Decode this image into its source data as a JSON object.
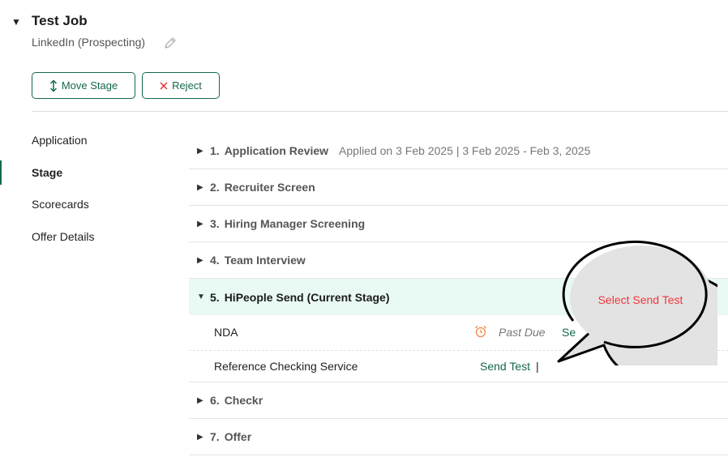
{
  "job": {
    "title": "Test Job",
    "subtitle": "LinkedIn (Prospecting)",
    "toggle_icon": "triangle-down",
    "edit_icon": "pencil-icon"
  },
  "actions": {
    "move_stage_label": "Move Stage",
    "reject_label": "Reject"
  },
  "sidenav": {
    "items": [
      {
        "label": "Application",
        "active": false
      },
      {
        "label": "Stage",
        "active": true
      },
      {
        "label": "Scorecards",
        "active": false
      },
      {
        "label": "Offer Details",
        "active": false
      }
    ]
  },
  "stages": [
    {
      "num": "1.",
      "name": "Application Review",
      "meta": "Applied on 3 Feb 2025 | 3 Feb 2025 - Feb 3, 2025",
      "expanded": false
    },
    {
      "num": "2.",
      "name": "Recruiter Screen",
      "meta": "",
      "expanded": false
    },
    {
      "num": "3.",
      "name": "Hiring Manager Screening",
      "meta": "",
      "expanded": false
    },
    {
      "num": "4.",
      "name": "Team Interview",
      "meta": "",
      "expanded": false
    },
    {
      "num": "5.",
      "name": "HiPeople Send (Current Stage)",
      "meta": "",
      "expanded": true,
      "items": [
        {
          "name": "NDA",
          "status": "Past Due",
          "action": "Se"
        },
        {
          "name": "Reference Checking Service",
          "status": "",
          "action": "Send Test",
          "cursor": "|"
        }
      ]
    },
    {
      "num": "6.",
      "name": "Checkr",
      "meta": "",
      "expanded": false
    },
    {
      "num": "7.",
      "name": "Offer",
      "meta": "",
      "expanded": false
    }
  ],
  "callout": {
    "text": "Select Send Test",
    "text_color": "#f0383c"
  },
  "colors": {
    "accent": "#14684a",
    "current_stage_bg": "#e9faf5",
    "reject_icon": "#e0353a",
    "alarm_icon": "#f28a4b"
  },
  "toggles": {
    "collapsed": "▶",
    "expanded": "▼"
  }
}
